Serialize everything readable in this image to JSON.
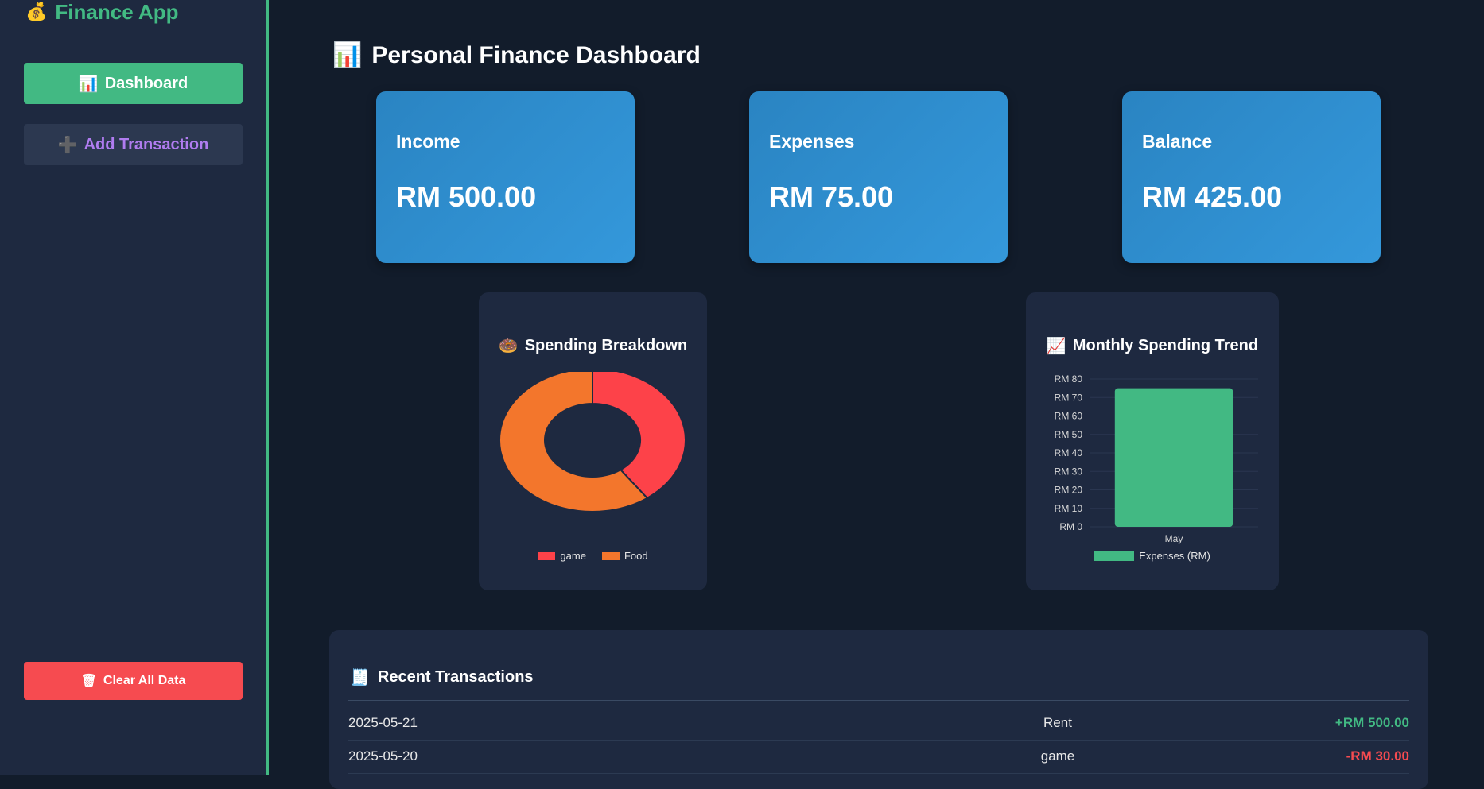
{
  "sidebar": {
    "brand_icon": "💰",
    "brand_title": "Finance App",
    "nav": {
      "dashboard_icon": "📊",
      "dashboard_label": "Dashboard",
      "add_icon": "➕",
      "add_label": "Add Transaction"
    },
    "clear_icon": "🗑",
    "clear_label": "Clear All Data"
  },
  "main": {
    "title_icon": "📊",
    "title": "Personal Finance Dashboard",
    "cards": [
      {
        "label": "Income",
        "value": "RM 500.00"
      },
      {
        "label": "Expenses",
        "value": "RM 75.00"
      },
      {
        "label": "Balance",
        "value": "RM 425.00"
      }
    ],
    "transactions": {
      "title_icon": "🧾",
      "title": "Recent Transactions",
      "rows": [
        {
          "date": "2025-05-21",
          "category": "Rent",
          "amount": "+RM 500.00",
          "type": "income"
        },
        {
          "date": "2025-05-20",
          "category": "game",
          "amount": "-RM 30.00",
          "type": "expense"
        }
      ]
    }
  },
  "colors": {
    "accent": "#42b983",
    "danger": "#f64b50",
    "card": "#3498db",
    "game": "#fd4249",
    "food": "#f3762c"
  },
  "chart_data": [
    {
      "type": "pie",
      "title_icon": "🍩",
      "title": "Spending Breakdown",
      "categories": [
        "game",
        "Food"
      ],
      "values": [
        30,
        45
      ],
      "colors": [
        "#fd4249",
        "#f3762c"
      ],
      "legend": "bottom"
    },
    {
      "type": "bar",
      "title_icon": "📈",
      "title": "Monthly Spending Trend",
      "categories": [
        "May"
      ],
      "series": [
        {
          "name": "Expenses (RM)",
          "values": [
            75
          ]
        }
      ],
      "ylim": [
        0,
        80
      ],
      "yticks": [
        "RM 0",
        "RM 10",
        "RM 20",
        "RM 30",
        "RM 40",
        "RM 50",
        "RM 60",
        "RM 70",
        "RM 80"
      ],
      "color": "#42b983",
      "legend": "bottom"
    }
  ]
}
